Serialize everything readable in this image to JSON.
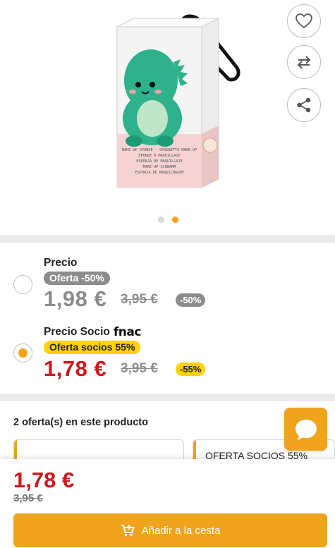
{
  "product": {
    "image_alt": "Esponja de maquillaje dinosaurio",
    "packaging_text": [
      "MAKE-UP SPONGE · SPUGNETTA MAKE-UP",
      "ÉPONGE À MAQUILLAGE",
      "ESPONJA DE MAQUILLAJE",
      "MAKE-UP-SCHWAMM",
      "ESPONJA DE MAQUILHAGEM"
    ],
    "carousel": {
      "total": 2,
      "active": 2
    }
  },
  "actions": {
    "favorite": "heart-icon",
    "compare": "compare-arrows-icon",
    "share": "share-icon"
  },
  "prices": {
    "regular": {
      "label": "Precio",
      "tag": "Oferta -50%",
      "price": "1,98 €",
      "old_price": "3,95 €",
      "discount": "-50%",
      "selected": false
    },
    "member": {
      "label": "Precio Socio",
      "brand": "fnac",
      "tag": "Oferta socios 55%",
      "price": "1,78 €",
      "old_price": "3,95 €",
      "discount": "-55%",
      "selected": true
    }
  },
  "offers": {
    "title": "2 oferta(s) en este producto",
    "cards": [
      {
        "text": ""
      },
      {
        "text": "OFERTA SOCIOS 55%"
      }
    ]
  },
  "bottom": {
    "price": "1,78 €",
    "old_price": "3,95 €",
    "cart_label": "Añadir a la cesta"
  },
  "colors": {
    "accent": "#f0a31d",
    "price_red": "#d0171b",
    "member_tag": "#ffd200",
    "grey_tag": "#8c8c8c"
  }
}
